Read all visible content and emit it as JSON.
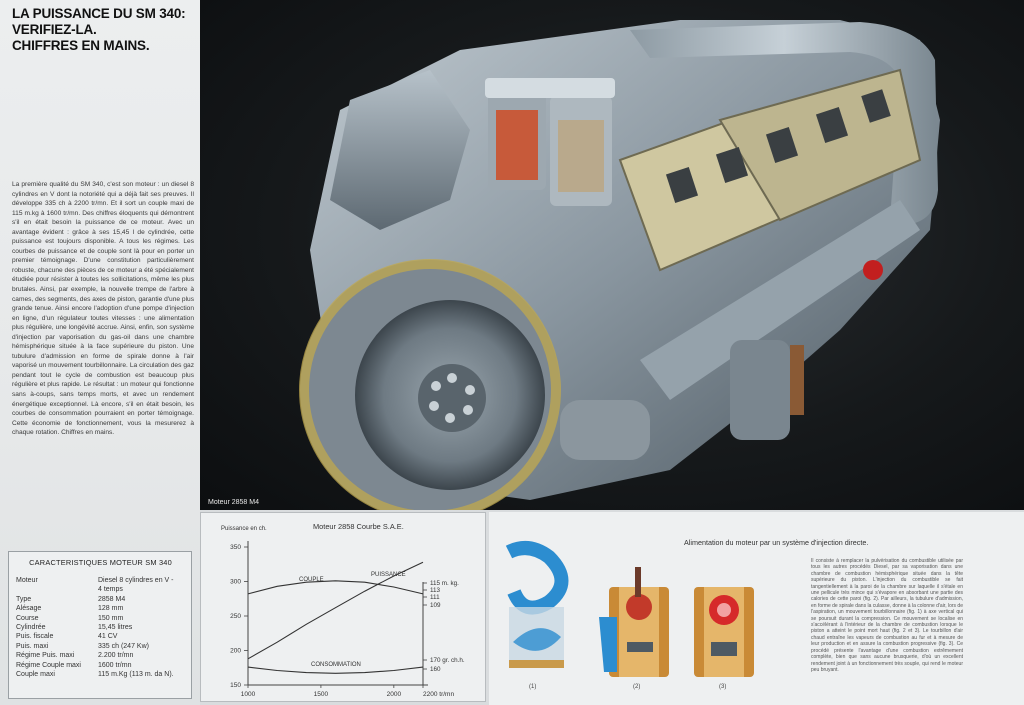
{
  "headline": [
    "LA PUISSANCE DU SM 340:",
    "VERIFIEZ-LA.",
    "CHIFFRES EN MAINS."
  ],
  "body_text": "La première qualité du SM 340, c'est son moteur : un diesel 8 cylindres en V dont la notoriété qui a déjà fait ses preuves. Il développe 335 ch à 2200 tr/mn. Et il sort un couple maxi de 115 m.kg à 1600 tr/mn. Des chiffres éloquents qui démontrent s'il en était besoin la puissance de ce moteur. Avec un avantage évident : grâce à ses 15,45 l de cylindrée, cette puissance est toujours disponible. A tous les régimes. Les courbes de puissance et de couple sont là pour en porter un premier témoignage. D'une constitution particulièrement robuste, chacune des pièces de ce moteur a été spécialement étudiée pour résister à toutes les sollicitations, même les plus brutales. Ainsi, par exemple, la nouvelle trempe de l'arbre à cames, des segments, des axes de piston, garantie d'une plus grande tenue. Ainsi encore l'adoption d'une pompe d'injection en ligne, d'un régulateur toutes vitesses : une alimentation plus régulière, une longévité accrue. Ainsi, enfin, son système d'injection par vaporisation du gas-oil dans une chambre hémisphérique située à la face supérieure du piston. Une tubulure d'admission en forme de spirale donne à l'air vaporisé un mouvement tourbillonnaire. La circulation des gaz pendant tout le cycle de combustion est beaucoup plus régulière et plus rapide. Le résultat : un moteur qui fonctionne sans à-coups, sans temps morts, et avec un rendement énergétique exceptionnel. Là encore, s'il en était besoin, les courbes de consommation pourraient en porter témoignage. Cette économie de fonctionnement, vous la mesurerez à chaque rotation. Chiffres en mains.",
  "specs": {
    "title": "CARACTERISTIQUES MOTEUR SM 340",
    "rows": [
      {
        "k": "Moteur",
        "v": "Diesel 8 cylindres en V -"
      },
      {
        "k": "",
        "v": "4 temps"
      },
      {
        "k": "Type",
        "v": "2858 M4"
      },
      {
        "k": "Alésage",
        "v": "128 mm"
      },
      {
        "k": "Course",
        "v": "150 mm"
      },
      {
        "k": "Cylindrée",
        "v": "15,45 litres"
      },
      {
        "k": "Puis. fiscale",
        "v": "41 CV"
      },
      {
        "k": "Puis. maxi",
        "v": "335 ch (247 Kw)"
      },
      {
        "k": "Régime Puis. maxi",
        "v": "2.200 tr/mn"
      },
      {
        "k": "Régime Couple maxi",
        "v": "1600 tr/mn"
      },
      {
        "k": "Couple maxi",
        "v": "115 m.Kg (113 m. da N)."
      }
    ]
  },
  "photo_caption": "Moteur 2858 M4",
  "chart_data": {
    "type": "line",
    "title": "Moteur 2858   Courbe S.A.E.",
    "ylabel": "Puissance en ch.",
    "xlabel": "tr/mn",
    "x_ticks": [
      "1000",
      "1500",
      "2000",
      "2200 tr/mn"
    ],
    "x_values": [
      1000,
      1500,
      2000,
      2200
    ],
    "y_ticks": [
      "350",
      "300",
      "250",
      "200",
      "150"
    ],
    "y_values": [
      350,
      300,
      250,
      200,
      150
    ],
    "xlim": [
      1000,
      2200
    ],
    "ylim": [
      150,
      350
    ],
    "right_ticks_top": [
      "115 m. kg.",
      "113",
      "111",
      "109"
    ],
    "right_ticks_bottom": [
      "170 gr. ch.h.",
      "160"
    ],
    "series": [
      {
        "name": "PUISSANCE",
        "x": [
          1000,
          1200,
          1400,
          1600,
          1800,
          2000,
          2200
        ],
        "y": [
          188,
          212,
          238,
          262,
          286,
          308,
          328
        ]
      },
      {
        "name": "COUPLE",
        "x": [
          1000,
          1200,
          1400,
          1600,
          1800,
          2000,
          2200
        ],
        "y": [
          282,
          293,
          299,
          301,
          299,
          292,
          282
        ]
      },
      {
        "name": "CONSOMMATION",
        "x": [
          1000,
          1200,
          1400,
          1600,
          1800,
          2000,
          2200
        ],
        "y": [
          176,
          171,
          168,
          167,
          168,
          171,
          176
        ]
      }
    ]
  },
  "injection": {
    "title": "Alimentation du moteur   par un système d'injection directe.",
    "text": "Il consiste à remplacer la pulvérisation du combustible utilisée par tous les autres procédés Diesel, par sa vaporisation dans une chambre de combustion hémisphérique située dans la tête supérieure du piston. L'injection du combustible se fait tangentiellement à la paroi de la chambre sur laquelle il s'étale en une pellicule très mince qui s'évapore en absorbant une partie des calories de cette paroi (fig. 2). Par ailleurs, la tubulure d'admission, en forme de spirale dans la culasse, donne à la colonne d'air, lors de l'aspiration, un mouvement tourbillonnaire (fig. 1) à axe vertical qui se poursuit durant la compression. Ce mouvement se localise en s'accélérant à l'intérieur de la chambre de combustion lorsque le piston a atteint le point mort haut (fig. 2 et 3). Le tourbillon d'air chaud entraîne les vapeurs de combustion au fur et à mesure de leur production et en assure la combustion progressive (fig. 3). Ce procédé présente l'avantage d'une combustion extrêmement complète, bien que sans aucune brusquerie, d'où un excellent rendement joint à un fonctionnement très souple, qui rend le moteur peu bruyant.",
    "figures": [
      "(1)",
      "(2)",
      "(3)"
    ]
  }
}
